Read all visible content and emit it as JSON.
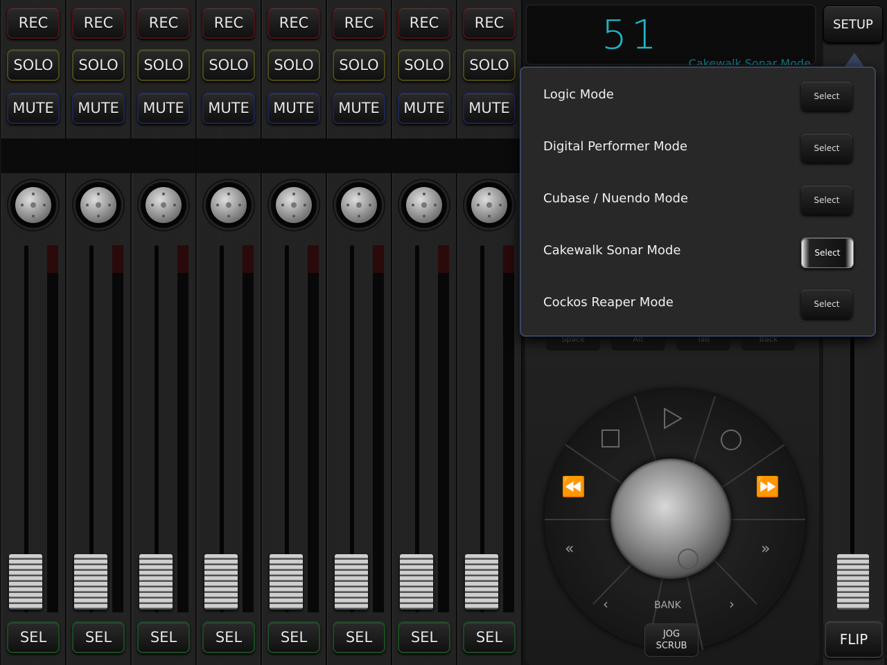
{
  "channels": [
    {
      "rec": "REC",
      "solo": "SOLO",
      "mute": "MUTE",
      "sel": "SEL"
    },
    {
      "rec": "REC",
      "solo": "SOLO",
      "mute": "MUTE",
      "sel": "SEL"
    },
    {
      "rec": "REC",
      "solo": "SOLO",
      "mute": "MUTE",
      "sel": "SEL"
    },
    {
      "rec": "REC",
      "solo": "SOLO",
      "mute": "MUTE",
      "sel": "SEL"
    },
    {
      "rec": "REC",
      "solo": "SOLO",
      "mute": "MUTE",
      "sel": "SEL"
    },
    {
      "rec": "REC",
      "solo": "SOLO",
      "mute": "MUTE",
      "sel": "SEL"
    },
    {
      "rec": "REC",
      "solo": "SOLO",
      "mute": "MUTE",
      "sel": "SEL"
    },
    {
      "rec": "REC",
      "solo": "SOLO",
      "mute": "MUTE",
      "sel": "SEL"
    }
  ],
  "display": {
    "number": "51",
    "mode": "Cakewalk Sonar Mode"
  },
  "setup_label": "SETUP",
  "flip_label": "FLIP",
  "keys": [
    "Space",
    "Alt",
    "Tab",
    "Back"
  ],
  "transport": {
    "bank": "BANK",
    "jog_line1": "JOG",
    "jog_line2": "SCRUB"
  },
  "accent_color": "#1fb5c4",
  "popover": {
    "items": [
      {
        "label": "Logic Mode",
        "button": "Select",
        "active": false
      },
      {
        "label": "Digital Performer Mode",
        "button": "Select",
        "active": false
      },
      {
        "label": "Cubase / Nuendo Mode",
        "button": "Select",
        "active": false
      },
      {
        "label": "Cakewalk Sonar Mode",
        "button": "Select",
        "active": true
      },
      {
        "label": "Cockos Reaper Mode",
        "button": "Select",
        "active": false
      }
    ]
  }
}
